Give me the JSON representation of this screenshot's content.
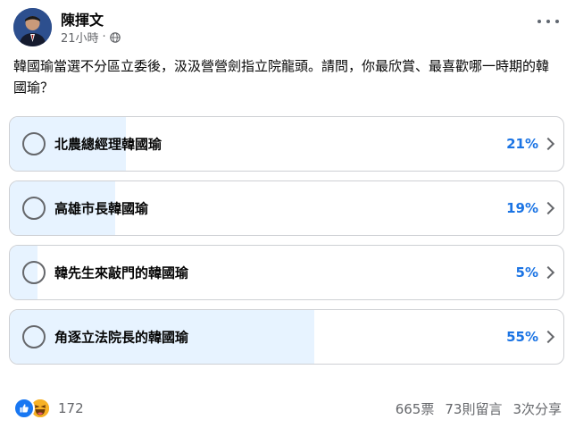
{
  "author": {
    "name": "陳揮文",
    "time": "21小時",
    "dot": "·",
    "privacy_icon": "globe-icon"
  },
  "post": {
    "text": "韓國瑜當選不分區立委後，汲汲營營劍指立院龍頭。請問，你最欣賞、最喜歡哪一時期的韓國瑜？"
  },
  "poll": {
    "options": [
      {
        "label": "北農總經理韓國瑜",
        "percent_text": "21%",
        "percent": 21
      },
      {
        "label": "高雄市長韓國瑜",
        "percent_text": "19%",
        "percent": 19
      },
      {
        "label": "韓先生來敲門的韓國瑜",
        "percent_text": "5%",
        "percent": 5
      },
      {
        "label": "角逐立法院長的韓國瑜",
        "percent_text": "55%",
        "percent": 55
      }
    ]
  },
  "footer": {
    "reaction_count": "172",
    "votes": "665票",
    "comments": "73則留言",
    "shares": "3次分享",
    "reaction_icons": [
      "like-icon",
      "haha-icon"
    ]
  },
  "colors": {
    "accent": "#1b74e4",
    "poll_fill": "#e7f3ff",
    "secondary_text": "#65676b"
  }
}
